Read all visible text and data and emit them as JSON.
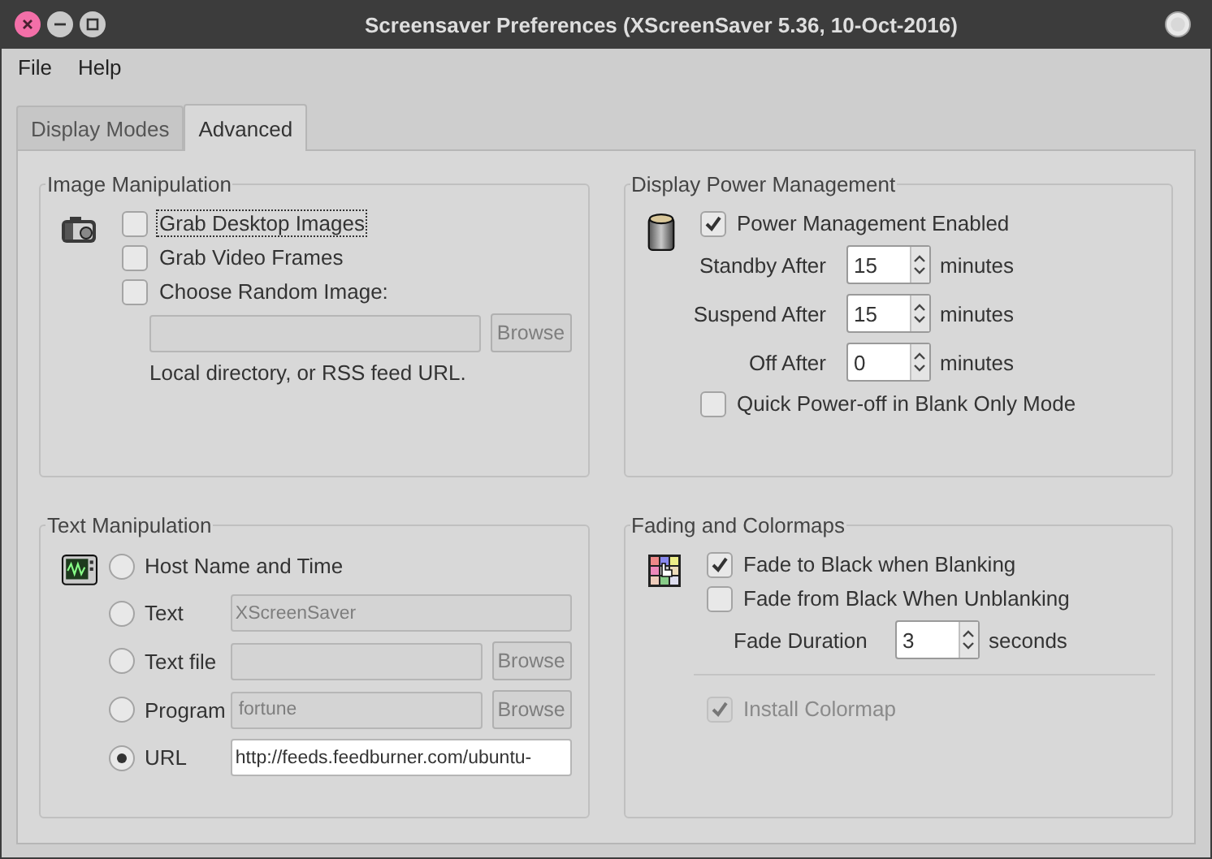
{
  "window": {
    "title": "Screensaver Preferences  (XScreenSaver 5.36, 10-Oct-2016)"
  },
  "menu": [
    "File",
    "Help"
  ],
  "tabs": [
    {
      "label": "Display Modes",
      "selected": false
    },
    {
      "label": "Advanced",
      "selected": true
    }
  ],
  "image_manipulation": {
    "title": "Image Manipulation",
    "options": [
      {
        "label": "Grab Desktop Images",
        "checked": false,
        "focused": true
      },
      {
        "label": "Grab Video Frames",
        "checked": false,
        "focused": false
      },
      {
        "label": "Choose Random Image:",
        "checked": false,
        "focused": false
      }
    ],
    "directory_field": {
      "disabled": true
    },
    "browse_button": {
      "label": "Browse",
      "disabled": true
    },
    "hint": "Local directory, or RSS feed URL."
  },
  "power_management": {
    "title": "Display Power Management",
    "enabled": {
      "label": "Power Management Enabled",
      "checked": true
    },
    "spinners": [
      {
        "label": "Standby After",
        "value": "15",
        "unit": "minutes"
      },
      {
        "label": "Suspend After",
        "value": "15",
        "unit": "minutes"
      },
      {
        "label": "Off After",
        "value": "0",
        "unit": "minutes"
      }
    ],
    "quick_off": {
      "label": "Quick Power-off in Blank Only Mode",
      "checked": false
    }
  },
  "text_manipulation": {
    "title": "Text Manipulation",
    "options": [
      {
        "kind": "plain",
        "label": "Host Name and Time",
        "selected": false
      },
      {
        "kind": "field",
        "label": "Text",
        "selected": false,
        "field": {
          "value": "XScreenSaver",
          "disabled": true
        }
      },
      {
        "kind": "browse",
        "label": "Text file",
        "selected": false,
        "field": {
          "disabled": true
        },
        "button": {
          "label": "Browse",
          "disabled": true
        }
      },
      {
        "kind": "browse",
        "label": "Program",
        "selected": false,
        "field": {
          "value": "fortune",
          "disabled": true
        },
        "button": {
          "label": "Browse",
          "disabled": true
        }
      },
      {
        "kind": "field",
        "label": "URL",
        "selected": true,
        "field": {
          "value": "http://feeds.feedburner.com/ubuntu-",
          "disabled": false
        }
      }
    ]
  },
  "fading": {
    "title": "Fading and Colormaps",
    "options": [
      {
        "label": "Fade to Black when Blanking",
        "checked": true
      },
      {
        "label": "Fade from Black When Unblanking",
        "checked": false
      }
    ],
    "duration": {
      "label": "Fade Duration",
      "value": "3",
      "unit": "seconds"
    },
    "colormap": {
      "label": "Install Colormap",
      "checked": true,
      "disabled": true
    }
  }
}
